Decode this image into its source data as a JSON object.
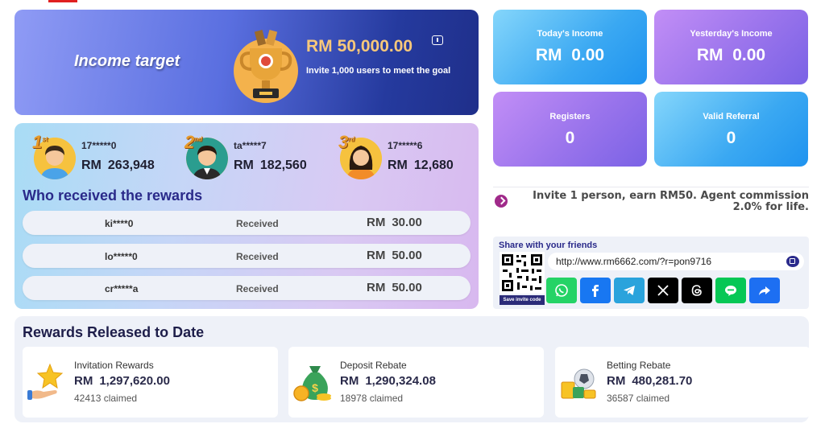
{
  "income_target": {
    "title": "Income target",
    "currency": "RM",
    "amount": "50,000.00",
    "subtitle": "Invite 1,000 users to meet the goal"
  },
  "stats": {
    "today": {
      "label": "Today's Income",
      "currency": "RM",
      "value": "0.00"
    },
    "yesterday": {
      "label": "Yesterday's Income",
      "currency": "RM",
      "value": "0.00"
    },
    "registers": {
      "label": "Registers",
      "value": "0"
    },
    "valid_referral": {
      "label": "Valid Referral",
      "value": "0"
    }
  },
  "leaderboard": [
    {
      "rank": "1",
      "rank_suffix": "st",
      "user": "17*****0",
      "currency": "RM",
      "amount": "263,948"
    },
    {
      "rank": "2",
      "rank_suffix": "nd",
      "user": "ta*****7",
      "currency": "RM",
      "amount": "182,560"
    },
    {
      "rank": "3",
      "rank_suffix": "rd",
      "user": "17*****6",
      "currency": "RM",
      "amount": "12,680"
    }
  ],
  "rewards_received": {
    "heading": "Who received the rewards",
    "rows": [
      {
        "user": "ki****0",
        "status": "Received",
        "currency": "RM",
        "amount": "30.00"
      },
      {
        "user": "lo*****0",
        "status": "Received",
        "currency": "RM",
        "amount": "50.00"
      },
      {
        "user": "cr*****a",
        "status": "Received",
        "currency": "RM",
        "amount": "50.00"
      }
    ]
  },
  "invite": {
    "text": "Invite 1 person, earn RM50. Agent commission 2.0% for life."
  },
  "share": {
    "title": "Share with your friends",
    "link": "http://www.rm6662.com/?r=pon9716",
    "save_code_label": "Save invite code",
    "buttons": [
      {
        "name": "whatsapp",
        "color": "#25d366"
      },
      {
        "name": "facebook",
        "color": "#1877f2"
      },
      {
        "name": "telegram",
        "color": "#2aa3dc"
      },
      {
        "name": "x",
        "color": "#000000"
      },
      {
        "name": "threads",
        "color": "#000000"
      },
      {
        "name": "line",
        "color": "#06c755"
      },
      {
        "name": "share",
        "color": "#1d6ff2"
      }
    ]
  },
  "released": {
    "heading": "Rewards Released to Date",
    "cards": [
      {
        "label": "Invitation Rewards",
        "currency": "RM",
        "amount": "1,297,620.00",
        "claimed": "42413 claimed"
      },
      {
        "label": "Deposit Rebate",
        "currency": "RM",
        "amount": "1,290,324.08",
        "claimed": "18978 claimed"
      },
      {
        "label": "Betting Rebate",
        "currency": "RM",
        "amount": "480,281.70",
        "claimed": "36587 claimed"
      }
    ]
  }
}
